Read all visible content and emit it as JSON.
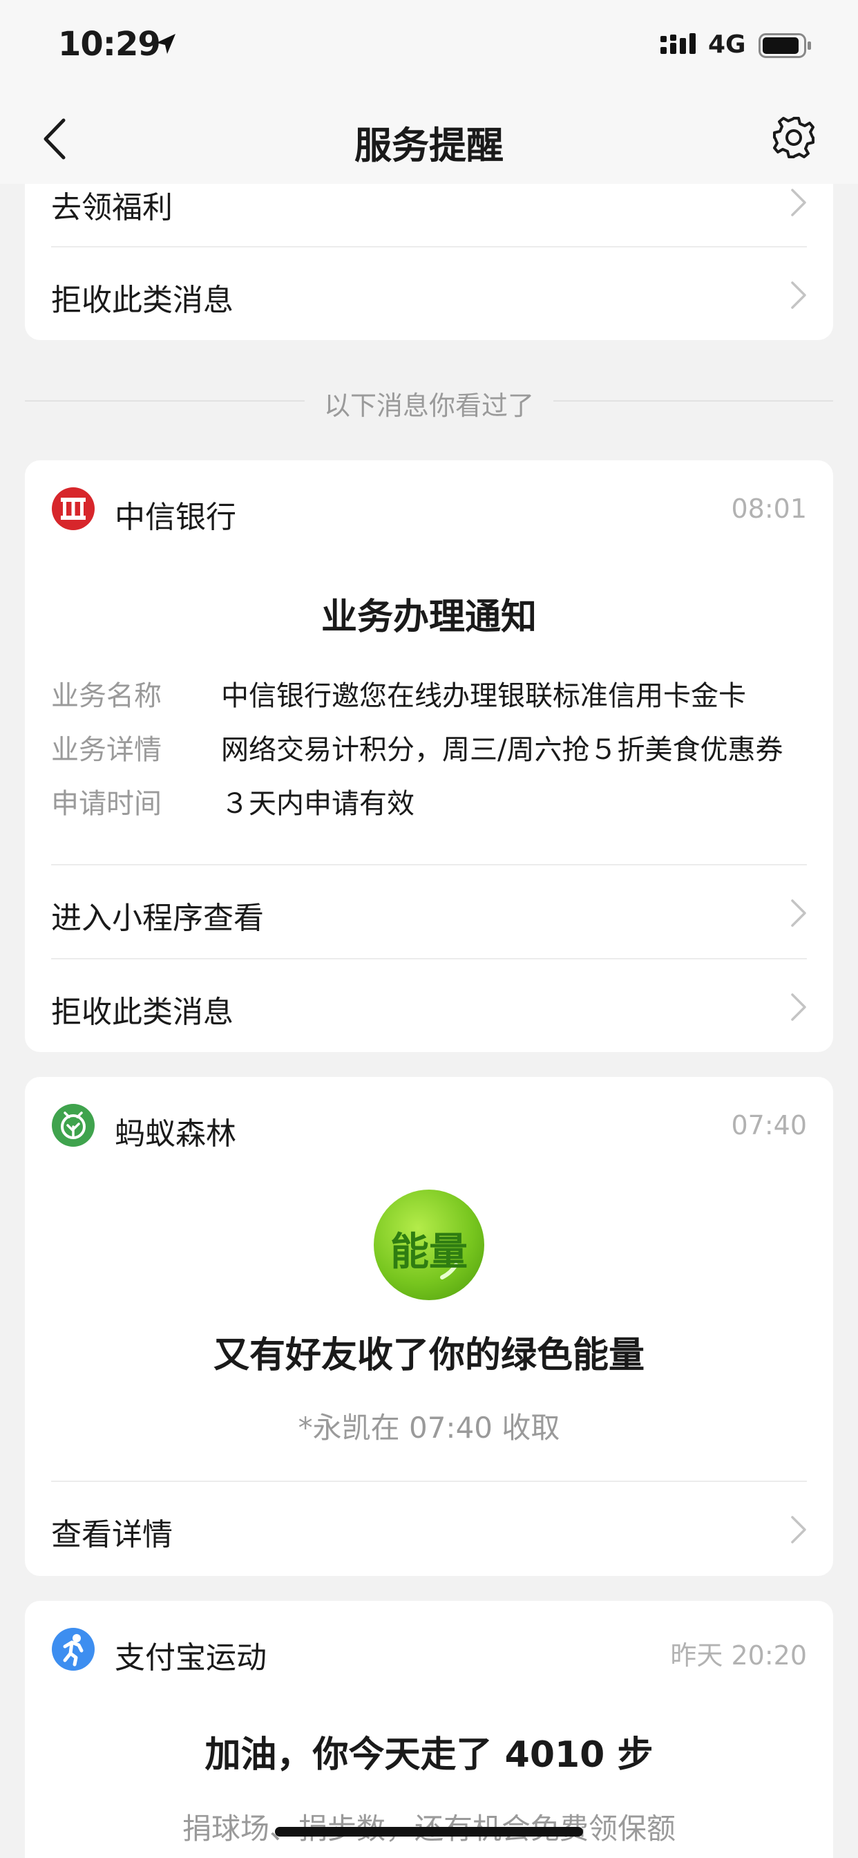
{
  "status": {
    "time": "10:29",
    "network": "4G"
  },
  "nav": {
    "title": "服务提醒"
  },
  "card_top": {
    "rows": [
      {
        "label": "去领福利"
      },
      {
        "label": "拒收此类消息"
      }
    ]
  },
  "seen_divider": "以下消息你看过了",
  "card_citic": {
    "sender": "中信银行",
    "time": "08:01",
    "title": "业务办理通知",
    "details": [
      {
        "key": "业务名称",
        "value": "中信银行邀您在线办理银联标准信用卡金卡"
      },
      {
        "key": "业务详情",
        "value": "网络交易计积分，周三/周六抢５折美食优惠券"
      },
      {
        "key": "申请时间",
        "value": "３天内申请有效"
      }
    ],
    "rows": [
      {
        "label": "进入小程序查看"
      },
      {
        "label": "拒收此类消息"
      }
    ]
  },
  "card_forest": {
    "sender": "蚂蚁森林",
    "time": "07:40",
    "badge": "能量",
    "title": "又有好友收了你的绿色能量",
    "subtitle": "*永凯在 07:40 收取",
    "rows": [
      {
        "label": "查看详情"
      }
    ]
  },
  "card_sport": {
    "sender": "支付宝运动",
    "time": "昨天 20:20",
    "title": "加油，你今天走了 4010 步",
    "subtitle": "捐球场、捐步数，还有机会免费领保额"
  },
  "colors": {
    "background": "#f2f2f2",
    "card": "#ffffff",
    "citic_red": "#d7262b",
    "forest_green": "#3fa34d",
    "energy_green": "#7ccd28",
    "sport_blue": "#3d8ef0"
  },
  "icons": [
    "location-arrow-icon",
    "signal-icon",
    "battery-icon",
    "back-chevron-icon",
    "settings-gear-icon",
    "chevron-right-icon",
    "citic-logo-icon",
    "ant-forest-logo-icon",
    "alipay-sport-logo-icon"
  ]
}
